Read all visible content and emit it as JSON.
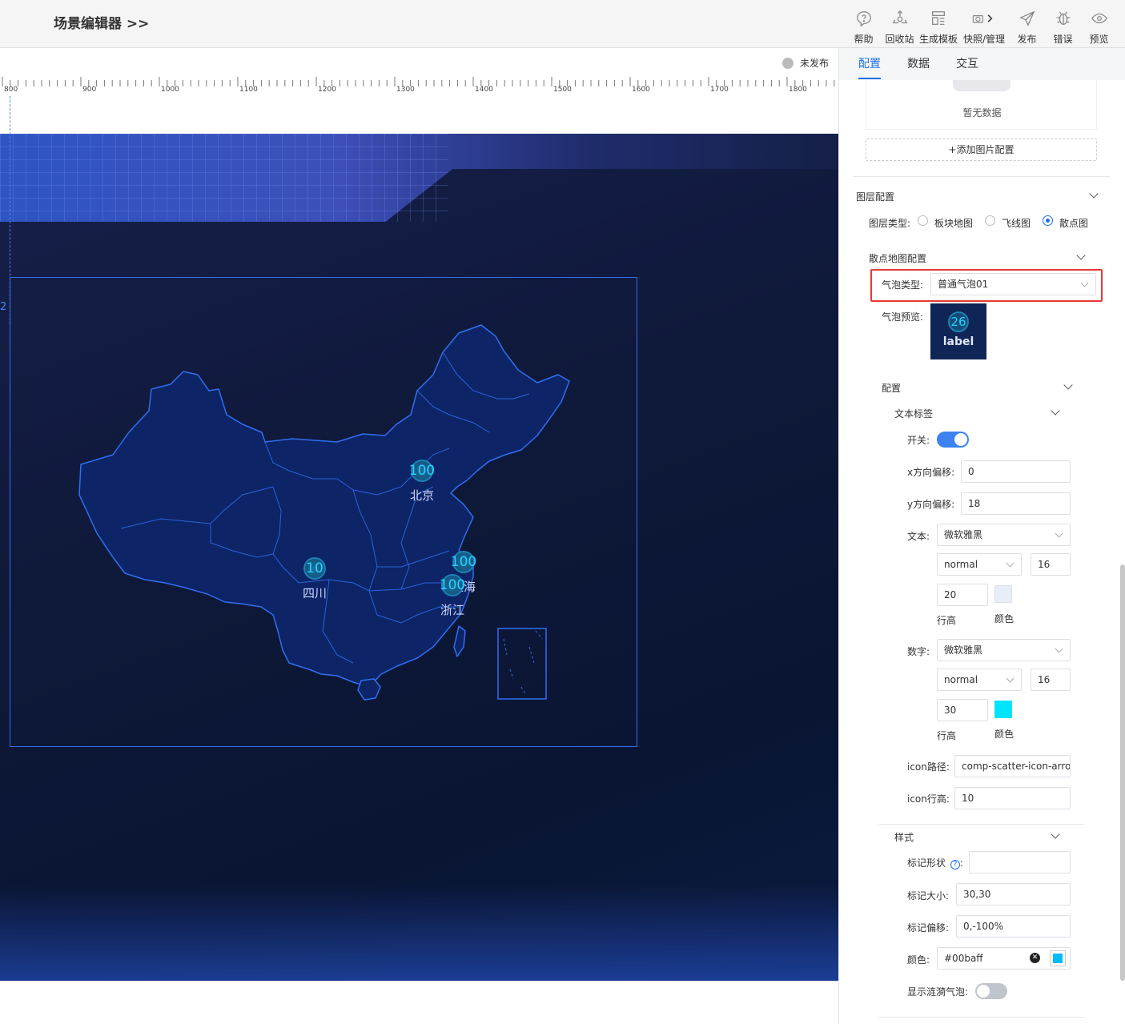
{
  "app": {
    "title": "场景编辑器 >>"
  },
  "toolbar": [
    {
      "label": "帮助",
      "icon": "help-icon"
    },
    {
      "label": "回收站",
      "icon": "recycle-icon"
    },
    {
      "label": "生成模板",
      "icon": "template-icon"
    },
    {
      "label": "快照/管理",
      "icon": "camera-icon"
    },
    {
      "label": "发布",
      "icon": "send-icon"
    },
    {
      "label": "错误",
      "icon": "bug-icon"
    },
    {
      "label": "预览",
      "icon": "eye-icon"
    }
  ],
  "canvas": {
    "status": "未发布",
    "ruler_labels": [
      "800",
      "900",
      "1000",
      "1100",
      "1200",
      "1300",
      "1400",
      "1500",
      "1600",
      "1700",
      "1800"
    ],
    "guide_number": "2",
    "map_points": [
      {
        "value": "100",
        "name": "北京"
      },
      {
        "value": "10",
        "name": "四川"
      },
      {
        "value": "100",
        "name": "上海"
      },
      {
        "value": "100",
        "name": "浙江"
      }
    ]
  },
  "panel": {
    "tabs": [
      {
        "label": "配置",
        "active": true
      },
      {
        "label": "数据",
        "active": false
      },
      {
        "label": "交互",
        "active": false
      }
    ],
    "image": {
      "empty_text": "暂无数据",
      "add_button": "+添加图片配置"
    },
    "layer": {
      "section": "图层配置",
      "type_label": "图层类型:",
      "options": [
        "板块地图",
        "飞线图",
        "散点图"
      ],
      "selected": "散点图"
    },
    "scatter": {
      "section": "散点地图配置",
      "bubble_type_label": "气泡类型:",
      "bubble_type_value": "普通气泡01",
      "preview_label": "气泡预览:",
      "preview_number": "26",
      "preview_text": "label"
    },
    "config": {
      "section": "配置",
      "text_label_section": "文本标签",
      "switch_label": "开关:",
      "switch_on": true,
      "x_offset_label": "x方向偏移:",
      "x_offset": "0",
      "y_offset_label": "y方向偏移:",
      "y_offset": "18",
      "text_label": "文本:",
      "text_font": "微软雅黑",
      "text_weight": "normal",
      "text_size": "16",
      "text_line_height": "20",
      "text_line_height_caption": "行高",
      "text_color_caption": "颜色",
      "text_color": "#e8eef8",
      "number_label": "数字:",
      "number_font": "微软雅黑",
      "number_weight": "normal",
      "number_size": "16",
      "number_line_height": "30",
      "number_line_height_caption": "行高",
      "number_color_caption": "颜色",
      "number_color": "#00e5ff",
      "icon_path_label": "icon路径:",
      "icon_path": "comp-scatter-icon-arrow",
      "icon_line_height_label": "icon行高:",
      "icon_line_height": "10"
    },
    "style": {
      "section": "样式",
      "marker_shape_label": "标记形状",
      "marker_shape": "",
      "marker_size_label": "标记大小:",
      "marker_size": "30,30",
      "marker_offset_label": "标记偏移:",
      "marker_offset": "0,-100%",
      "color_label": "颜色:",
      "color_value": "#00baff",
      "ripple_label": "显示涟漪气泡:",
      "ripple_on": false
    }
  },
  "colors": {
    "accent": "#1e6fe8",
    "highlight_box": "#e53935",
    "map_fill": "#0d2466",
    "map_stroke": "#2f6ff0"
  }
}
